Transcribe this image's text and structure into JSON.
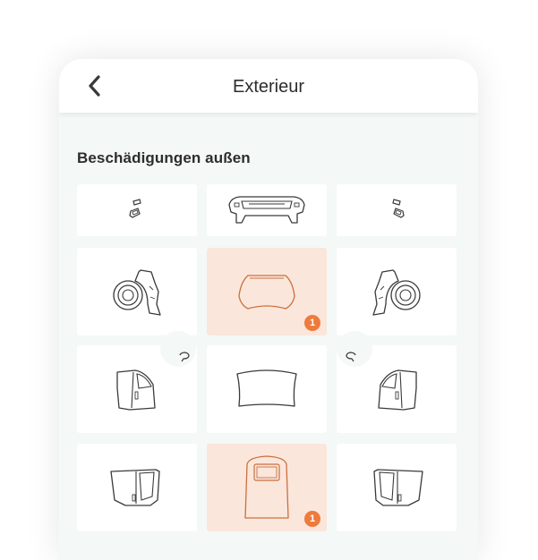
{
  "header": {
    "title": "Exterieur",
    "back_icon": "chevron-left-icon"
  },
  "section": {
    "title": "Beschädigungen außen"
  },
  "colors": {
    "selected_bg": "#fbe6db",
    "badge": "#ee7a3b",
    "stroke_default": "#3a3a3a",
    "stroke_selected": "#c9703f"
  },
  "tiles": [
    {
      "part": "left-mirror-icon",
      "badge": ""
    },
    {
      "part": "front-bumper-icon",
      "badge": ""
    },
    {
      "part": "right-mirror-icon",
      "badge": ""
    },
    {
      "part": "left-front-wheel-icon",
      "badge": ""
    },
    {
      "part": "hood-icon",
      "badge": "1"
    },
    {
      "part": "right-front-wheel-icon",
      "badge": ""
    },
    {
      "part": "left-front-door-icon",
      "badge": ""
    },
    {
      "part": "windshield-icon",
      "badge": ""
    },
    {
      "part": "right-front-door-icon",
      "badge": ""
    },
    {
      "part": "left-side-panel-icon",
      "badge": ""
    },
    {
      "part": "roof-icon",
      "badge": "1"
    },
    {
      "part": "right-side-panel-icon",
      "badge": ""
    }
  ]
}
